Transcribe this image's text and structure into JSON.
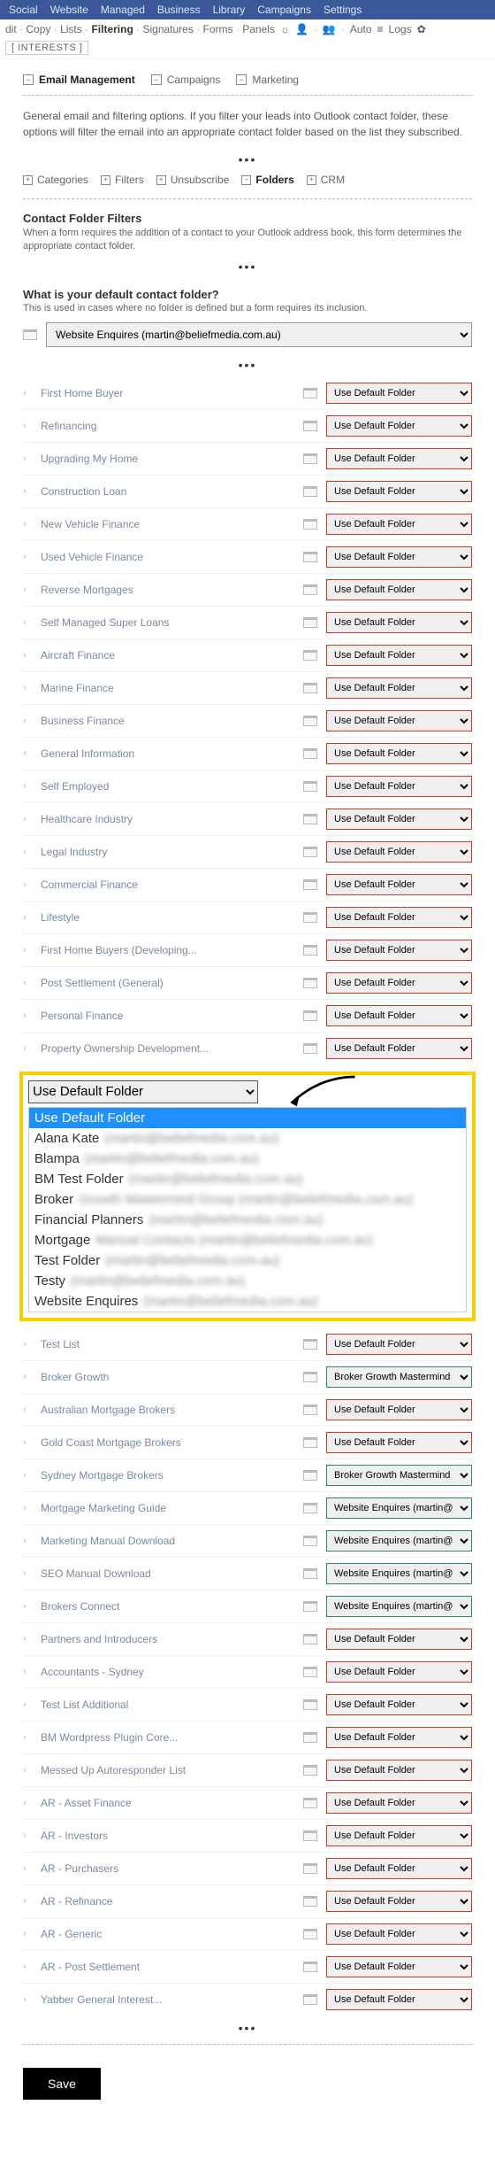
{
  "topnav": [
    "Social",
    "Website",
    "Managed",
    "Business",
    "Library",
    "Campaigns",
    "Settings"
  ],
  "toolbar": {
    "items": [
      "dit",
      "Copy",
      "Lists",
      "Filtering",
      "Signatures",
      "Forms",
      "Panels"
    ],
    "active": "Filtering",
    "auto": "Auto",
    "logs": "Logs",
    "interests": "INTERESTS"
  },
  "tabs": {
    "email_mgmt": "Email Management",
    "campaigns": "Campaigns",
    "marketing": "Marketing"
  },
  "intro": "General email and filtering options. If you filter your leads into Outlook contact folder, these options will filter the email into an appropriate contact folder based on the list they subscribed.",
  "subtabs": {
    "categories": "Categories",
    "filters": "Filters",
    "unsubscribe": "Unsubscribe",
    "folders": "Folders",
    "crm": "CRM"
  },
  "section": {
    "title": "Contact Folder Filters",
    "desc": "When a form requires the addition of a contact to your Outlook address book, this form determines the appropriate contact folder."
  },
  "question": {
    "title": "What is your default contact folder?",
    "desc": "This is used in cases where no folder is defined but a form requires its inclusion."
  },
  "default_folder": "Website Enquires (martin@beliefmedia.com.au)",
  "default_value": "Use Default Folder",
  "broker_growth_value": "Broker Growth Mastermind Gro",
  "website_enq_value": "Website Enquires (martin@beli",
  "rows_top": [
    {
      "label": "First Home Buyer",
      "val": "default",
      "border": "red"
    },
    {
      "label": "Refinancing",
      "val": "default",
      "border": "red"
    },
    {
      "label": "Upgrading My Home",
      "val": "default",
      "border": "red"
    },
    {
      "label": "Construction Loan",
      "val": "default",
      "border": "red"
    },
    {
      "label": "New Vehicle Finance",
      "val": "default",
      "border": "red"
    },
    {
      "label": "Used Vehicle Finance",
      "val": "default",
      "border": "red"
    },
    {
      "label": "Reverse Mortgages",
      "val": "default",
      "border": "red"
    },
    {
      "label": "Self Managed Super Loans",
      "val": "default",
      "border": "red"
    },
    {
      "label": "Aircraft Finance",
      "val": "default",
      "border": "red"
    },
    {
      "label": "Marine Finance",
      "val": "default",
      "border": "red"
    },
    {
      "label": "Business Finance",
      "val": "default",
      "border": "red"
    },
    {
      "label": "General Information",
      "val": "default",
      "border": "red"
    },
    {
      "label": "Self Employed",
      "val": "default",
      "border": "red"
    },
    {
      "label": "Healthcare Industry",
      "val": "default",
      "border": "red"
    },
    {
      "label": "Legal Industry",
      "val": "default",
      "border": "red"
    },
    {
      "label": "Commercial Finance",
      "val": "default",
      "border": "red"
    },
    {
      "label": "Lifestyle",
      "val": "default",
      "border": "red"
    },
    {
      "label": "First Home Buyers (Developing...",
      "val": "default",
      "border": "red"
    },
    {
      "label": "Post Settlement (General)",
      "val": "default",
      "border": "red"
    },
    {
      "label": "Personal Finance",
      "val": "default",
      "border": "red"
    },
    {
      "label": "Property Ownership Development...",
      "val": "default",
      "border": "red"
    }
  ],
  "overlay": {
    "selected": "Use Default Folder",
    "options": [
      {
        "name": "Use Default Folder",
        "blur": ""
      },
      {
        "name": "Alana Kate",
        "blur": "(martin@beliefmedia.com.au)"
      },
      {
        "name": "Blampa",
        "blur": "(martin@beliefmedia.com.au)"
      },
      {
        "name": "BM Test Folder",
        "blur": "(martin@beliefmedia.com.au)"
      },
      {
        "name": "Broker",
        "blur": "Growth Mastermind Group (martin@beliefmedia.com.au)"
      },
      {
        "name": "Financial Planners",
        "blur": "(martin@beliefmedia.com.au)"
      },
      {
        "name": "Mortgage",
        "blur": "Manual Contacts (martin@beliefmedia.com.au)"
      },
      {
        "name": "Test Folder",
        "blur": "(martin@beliefmedia.com.au)"
      },
      {
        "name": "Testy",
        "blur": "(martin@beliefmedia.com.au)"
      },
      {
        "name": "Website Enquires",
        "blur": "(martin@beliefmedia.com.au)"
      }
    ]
  },
  "rows_bottom": [
    {
      "label": "Test List",
      "val": "default",
      "border": "red"
    },
    {
      "label": "Broker Growth",
      "val": "broker",
      "border": "green"
    },
    {
      "label": "Australian Mortgage Brokers",
      "val": "default",
      "border": "red"
    },
    {
      "label": "Gold Coast Mortgage Brokers",
      "val": "default",
      "border": "red"
    },
    {
      "label": "Sydney Mortgage Brokers",
      "val": "broker",
      "border": "green"
    },
    {
      "label": "Mortgage Marketing Guide",
      "val": "website",
      "border": "green"
    },
    {
      "label": "Marketing Manual Download",
      "val": "website",
      "border": "green"
    },
    {
      "label": "SEO Manual Download",
      "val": "website",
      "border": "green"
    },
    {
      "label": "Brokers Connect",
      "val": "website",
      "border": "green"
    },
    {
      "label": "Partners and Introducers",
      "val": "default",
      "border": "red"
    },
    {
      "label": "Accountants - Sydney",
      "val": "default",
      "border": "red"
    },
    {
      "label": "Test List Additional",
      "val": "default",
      "border": "red"
    },
    {
      "label": "BM Wordpress Plugin Core...",
      "val": "default",
      "border": "red"
    },
    {
      "label": "Messed Up Autoresponder List",
      "val": "default",
      "border": "red"
    },
    {
      "label": "AR - Asset Finance",
      "val": "default",
      "border": "red"
    },
    {
      "label": "AR - Investors",
      "val": "default",
      "border": "red"
    },
    {
      "label": "AR - Purchasers",
      "val": "default",
      "border": "red"
    },
    {
      "label": "AR - Refinance",
      "val": "default",
      "border": "red"
    },
    {
      "label": "AR - Generic",
      "val": "default",
      "border": "red"
    },
    {
      "label": "AR - Post Settlement",
      "val": "default",
      "border": "red"
    },
    {
      "label": "Yabber General Interest...",
      "val": "default",
      "border": "red"
    }
  ],
  "save": "Save"
}
